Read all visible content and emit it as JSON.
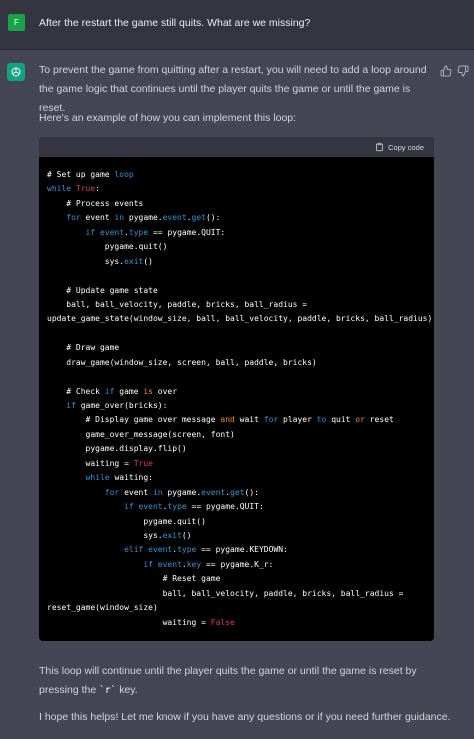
{
  "user": {
    "avatar_letter": "F",
    "avatar_color": "#16a34a",
    "message": "After the restart the game still quits. What are we missing?"
  },
  "assistant": {
    "avatar_color": "#10a37f",
    "intro": "To prevent the game from quitting after a restart, you will need to add a loop around the game logic that continues until the player quits the game or until the game is reset.",
    "example_intro": "Here's an example of how you can implement this loop:",
    "code": {
      "copy_label": "Copy code",
      "lines": [
        {
          "segs": [
            {
              "t": "# Set up game ",
              "c": "c"
            },
            {
              "t": "loop",
              "c": "kw"
            }
          ]
        },
        {
          "segs": [
            {
              "t": "while",
              "c": "kw"
            },
            {
              "t": " ",
              "c": "p"
            },
            {
              "t": "True",
              "c": "lit"
            },
            {
              "t": ":",
              "c": "p"
            }
          ]
        },
        {
          "segs": [
            {
              "t": "    # Process events",
              "c": "c"
            }
          ]
        },
        {
          "segs": [
            {
              "t": "    ",
              "c": "p"
            },
            {
              "t": "for",
              "c": "kw"
            },
            {
              "t": " event ",
              "c": "p"
            },
            {
              "t": "in",
              "c": "kw"
            },
            {
              "t": " pygame.",
              "c": "p"
            },
            {
              "t": "event",
              "c": "kw"
            },
            {
              "t": ".",
              "c": "p"
            },
            {
              "t": "get",
              "c": "kw"
            },
            {
              "t": "():",
              "c": "p"
            }
          ]
        },
        {
          "segs": [
            {
              "t": "        ",
              "c": "p"
            },
            {
              "t": "if",
              "c": "kw"
            },
            {
              "t": " ",
              "c": "p"
            },
            {
              "t": "event",
              "c": "kw"
            },
            {
              "t": ".",
              "c": "p"
            },
            {
              "t": "type",
              "c": "kw"
            },
            {
              "t": " == pygame.QUIT:",
              "c": "p"
            }
          ]
        },
        {
          "segs": [
            {
              "t": "            pygame.quit()",
              "c": "p"
            }
          ]
        },
        {
          "segs": [
            {
              "t": "            sys.",
              "c": "p"
            },
            {
              "t": "exit",
              "c": "kw"
            },
            {
              "t": "()",
              "c": "p"
            }
          ]
        },
        {
          "segs": [
            {
              "t": "",
              "c": "p"
            }
          ]
        },
        {
          "segs": [
            {
              "t": "    # Update game state",
              "c": "c"
            }
          ]
        },
        {
          "segs": [
            {
              "t": "    ball, ball_velocity, paddle, bricks, ball_radius =",
              "c": "p"
            }
          ]
        },
        {
          "segs": [
            {
              "t": "update_game_state(window_size, ball, ball_velocity, paddle, bricks, ball_radius)",
              "c": "p"
            }
          ]
        },
        {
          "segs": [
            {
              "t": "",
              "c": "p"
            }
          ]
        },
        {
          "segs": [
            {
              "t": "    # Draw game",
              "c": "c"
            }
          ]
        },
        {
          "segs": [
            {
              "t": "    draw_game(window_size, screen, ball, paddle, bricks)",
              "c": "p"
            }
          ]
        },
        {
          "segs": [
            {
              "t": "",
              "c": "p"
            }
          ]
        },
        {
          "segs": [
            {
              "t": "    # Check ",
              "c": "c"
            },
            {
              "t": "if",
              "c": "kw"
            },
            {
              "t": " game ",
              "c": "c"
            },
            {
              "t": "is",
              "c": "bi"
            },
            {
              "t": " over",
              "c": "c"
            }
          ]
        },
        {
          "segs": [
            {
              "t": "    ",
              "c": "p"
            },
            {
              "t": "if",
              "c": "kw"
            },
            {
              "t": " game_over(bricks):",
              "c": "p"
            }
          ]
        },
        {
          "segs": [
            {
              "t": "        # Display game over message ",
              "c": "c"
            },
            {
              "t": "and",
              "c": "bi"
            },
            {
              "t": " wait ",
              "c": "c"
            },
            {
              "t": "for",
              "c": "kw"
            },
            {
              "t": " player ",
              "c": "c"
            },
            {
              "t": "to",
              "c": "kw"
            },
            {
              "t": " quit ",
              "c": "c"
            },
            {
              "t": "or",
              "c": "bi"
            },
            {
              "t": " reset",
              "c": "c"
            }
          ]
        },
        {
          "segs": [
            {
              "t": "        game_over_message(screen, font)",
              "c": "p"
            }
          ]
        },
        {
          "segs": [
            {
              "t": "        pygame.display.flip()",
              "c": "p"
            }
          ]
        },
        {
          "segs": [
            {
              "t": "        waiting = ",
              "c": "p"
            },
            {
              "t": "True",
              "c": "lit"
            }
          ]
        },
        {
          "segs": [
            {
              "t": "        ",
              "c": "p"
            },
            {
              "t": "while",
              "c": "kw"
            },
            {
              "t": " waiting:",
              "c": "p"
            }
          ]
        },
        {
          "segs": [
            {
              "t": "            ",
              "c": "p"
            },
            {
              "t": "for",
              "c": "kw"
            },
            {
              "t": " event ",
              "c": "p"
            },
            {
              "t": "in",
              "c": "kw"
            },
            {
              "t": " pygame.",
              "c": "p"
            },
            {
              "t": "event",
              "c": "kw"
            },
            {
              "t": ".",
              "c": "p"
            },
            {
              "t": "get",
              "c": "kw"
            },
            {
              "t": "():",
              "c": "p"
            }
          ]
        },
        {
          "segs": [
            {
              "t": "                ",
              "c": "p"
            },
            {
              "t": "if",
              "c": "kw"
            },
            {
              "t": " ",
              "c": "p"
            },
            {
              "t": "event",
              "c": "kw"
            },
            {
              "t": ".",
              "c": "p"
            },
            {
              "t": "type",
              "c": "kw"
            },
            {
              "t": " == pygame.QUIT:",
              "c": "p"
            }
          ]
        },
        {
          "segs": [
            {
              "t": "                    pygame.quit()",
              "c": "p"
            }
          ]
        },
        {
          "segs": [
            {
              "t": "                    sys.",
              "c": "p"
            },
            {
              "t": "exit",
              "c": "kw"
            },
            {
              "t": "()",
              "c": "p"
            }
          ]
        },
        {
          "segs": [
            {
              "t": "                ",
              "c": "p"
            },
            {
              "t": "elif",
              "c": "kw"
            },
            {
              "t": " ",
              "c": "p"
            },
            {
              "t": "event",
              "c": "kw"
            },
            {
              "t": ".",
              "c": "p"
            },
            {
              "t": "type",
              "c": "kw"
            },
            {
              "t": " == pygame.KEYDOWN:",
              "c": "p"
            }
          ]
        },
        {
          "segs": [
            {
              "t": "                    ",
              "c": "p"
            },
            {
              "t": "if",
              "c": "kw"
            },
            {
              "t": " ",
              "c": "p"
            },
            {
              "t": "event",
              "c": "kw"
            },
            {
              "t": ".",
              "c": "p"
            },
            {
              "t": "key",
              "c": "kw"
            },
            {
              "t": " == pygame.K_r:",
              "c": "p"
            }
          ]
        },
        {
          "segs": [
            {
              "t": "                        # Reset game",
              "c": "c"
            }
          ]
        },
        {
          "segs": [
            {
              "t": "                        ball, ball_velocity, paddle, bricks, ball_radius =",
              "c": "p"
            }
          ]
        },
        {
          "segs": [
            {
              "t": "reset_game(window_size)",
              "c": "p"
            }
          ]
        },
        {
          "segs": [
            {
              "t": "                        waiting = ",
              "c": "p"
            },
            {
              "t": "False",
              "c": "lit"
            }
          ]
        }
      ]
    },
    "outro_text": "This loop will continue until the player quits the game or until the game is reset by pressing the",
    "outro_key": "`r`",
    "outro_end": "key.",
    "closing": "I hope this helps! Let me know if you have any questions or if you need further guidance."
  },
  "icons": {
    "logo": "openai-logo-icon",
    "thumbs_up": "thumbs-up-icon",
    "thumbs_down": "thumbs-down-icon",
    "copy": "clipboard-icon"
  },
  "colors": {
    "user_bg": "#343541",
    "assistant_bg": "#444654",
    "code_bg": "#000000",
    "keyword": "#2e95d3",
    "builtin": "#e9950c",
    "literal": "#df3079"
  }
}
